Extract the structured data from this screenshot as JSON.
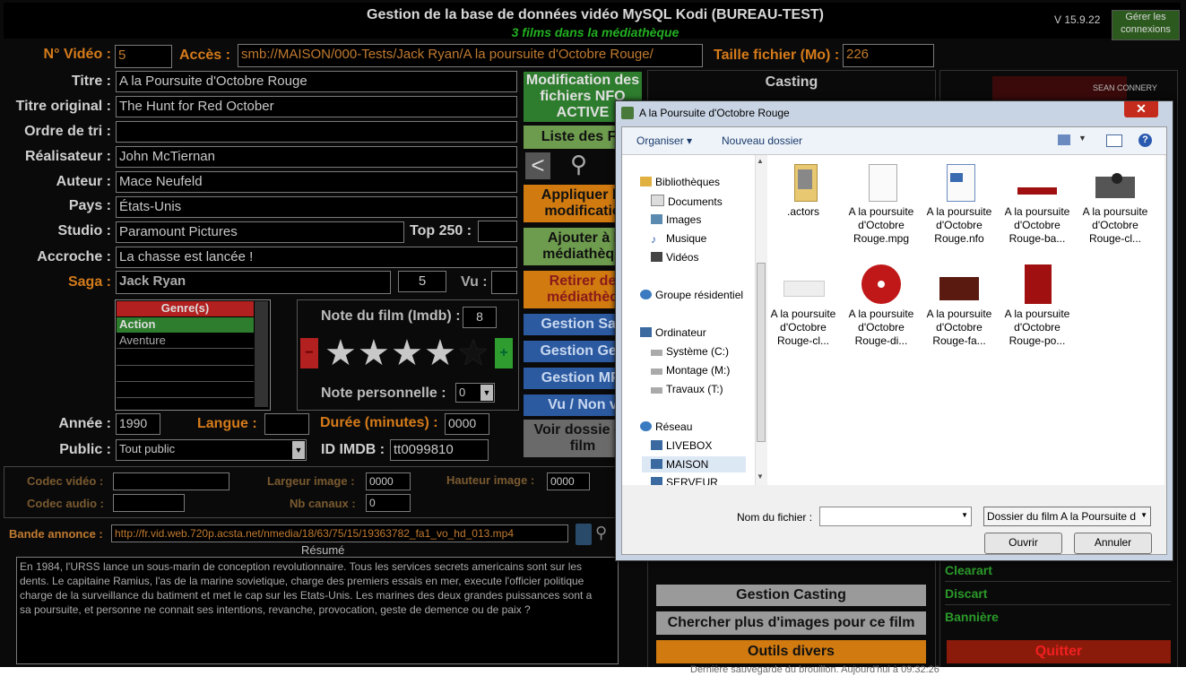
{
  "header": {
    "title": "Gestion de la base de données vidéo MySQL Kodi (BUREAU-TEST)",
    "subtitle": "3 films dans la médiathèque",
    "version": "V 15.9.22",
    "connections_button": "Gérer les connexions"
  },
  "form": {
    "video_no_label": "N° Vidéo :",
    "video_no": "5",
    "acces_label": "Accès :",
    "acces": "smb://MAISON/000-Tests/Jack Ryan/A la poursuite d'Octobre Rouge/",
    "taille_label": "Taille fichier (Mo) :",
    "taille": "226",
    "titre_label": "Titre :",
    "titre": "A la Poursuite d'Octobre Rouge",
    "titre_original_label": "Titre original :",
    "titre_original": "The Hunt for Red October",
    "ordre_label": "Ordre de tri :",
    "ordre": "",
    "realisateur_label": "Réalisateur :",
    "realisateur": "John McTiernan",
    "auteur_label": "Auteur :",
    "auteur": "Mace Neufeld",
    "pays_label": "Pays :",
    "pays": "États-Unis",
    "studio_label": "Studio :",
    "studio": "Paramount Pictures",
    "top250_label": "Top 250 :",
    "top250": "",
    "accroche_label": "Accroche :",
    "accroche": "La chasse est lancée !",
    "saga_label": "Saga :",
    "saga": "Jack Ryan",
    "saga_num": "5",
    "vu_label": "Vu :",
    "vu": "",
    "genres_header": "Genre(s)",
    "genres": [
      "Action",
      "Aventure",
      "",
      "",
      "",
      ""
    ],
    "note_label": "Note du film (Imdb) :",
    "note": "8",
    "stars_filled": 4,
    "stars_total": 5,
    "note_perso_label": "Note personnelle :",
    "note_perso": "0",
    "annee_label": "Année :",
    "annee": "1990",
    "langue_label": "Langue :",
    "langue": "",
    "duree_label": "Durée (minutes) :",
    "duree": "0000",
    "public_label": "Public :",
    "public": "Tout public",
    "imdb_label": "ID IMDB :",
    "imdb": "tt0099810",
    "codec_video_label": "Codec vidéo :",
    "codec_video": "",
    "largeur_label": "Largeur image :",
    "largeur": "0000",
    "hauteur_label": "Hauteur image :",
    "hauteur": "0000",
    "codec_audio_label": "Codec audio :",
    "codec_audio": "",
    "canaux_label": "Nb canaux :",
    "canaux": "0",
    "bande_label": "Bande annonce :",
    "bande": "http://fr.vid.web.720p.acsta.net/nmedia/18/63/75/15/19363782_fa1_vo_hd_013.mp4",
    "resume_label": "Résumé",
    "resume": "En 1984, l'URSS lance un sous-marin de conception revolutionnaire. Tous les services secrets americains sont sur les dents. Le capitaine Ramius, l'as de la marine sovietique, charge des premiers essais en mer, execute l'officier politique charge de la surveillance du batiment et met le cap sur les Etats-Unis. Les marines des deux grandes puissances sont a sa poursuite, et personne ne connait ses intentions, revanche, provocation, geste de demence ou de paix ?"
  },
  "buttons": {
    "modification": "Modification des fichiers NFO ACTIVE",
    "liste": "Liste des Fil",
    "appliquer": "Appliquer le modificatio",
    "ajouter": "Ajouter à l médiathèqu",
    "retirer": "Retirer de médiathèq",
    "gestion_saga": "Gestion Sag",
    "gestion_genre": "Gestion Gen",
    "gestion_mpaa": "Gestion MP/",
    "vu_non_vu": "Vu / Non v",
    "voir_dossier": "Voir dossie du film",
    "casting": "Casting",
    "gestion_casting": "Gestion Casting",
    "chercher_images": "Chercher plus d'images pour ce film",
    "outils": "Outils divers",
    "clearart": "Clearart",
    "discart": "Discart",
    "banniere": "Bannière",
    "quitter": "Quitter",
    "poster_text": "SEAN CONNERY"
  },
  "statusbar": "Dernière sauvegarde du brouillon. Aujourd'hui à 09:32:26",
  "dialog": {
    "title": "A la Poursuite d'Octobre Rouge",
    "close": "✕",
    "organiser": "Organiser ▾",
    "nouveau_dossier": "Nouveau dossier",
    "nav": [
      {
        "label": "Bibliothèques",
        "level": 0
      },
      {
        "label": "Documents",
        "level": 1
      },
      {
        "label": "Images",
        "level": 1
      },
      {
        "label": "Musique",
        "level": 1
      },
      {
        "label": "Vidéos",
        "level": 1
      },
      {
        "label": "Groupe résidentiel",
        "level": 0
      },
      {
        "label": "Ordinateur",
        "level": 0
      },
      {
        "label": "Système (C:)",
        "level": 1
      },
      {
        "label": "Montage (M:)",
        "level": 1
      },
      {
        "label": "Travaux (T:)",
        "level": 1
      },
      {
        "label": "Réseau",
        "level": 0
      },
      {
        "label": "LIVEBOX",
        "level": 1
      },
      {
        "label": "MAISON",
        "level": 1
      },
      {
        "label": "SERVEUR",
        "level": 1
      }
    ],
    "files": [
      {
        "name": ".actors",
        "kind": "folder"
      },
      {
        "name": "A la poursuite d'Octobre Rouge.mpg",
        "kind": "blank"
      },
      {
        "name": "A la poursuite d'Octobre Rouge.nfo",
        "kind": "nfo"
      },
      {
        "name": "A la poursuite d'Octobre Rouge-ba...",
        "kind": "banner"
      },
      {
        "name": "A la poursuite d'Octobre Rouge-cl...",
        "kind": "photo"
      },
      {
        "name": "A la poursuite d'Octobre Rouge-cl...",
        "kind": "clearlogo"
      },
      {
        "name": "A la poursuite d'Octobre Rouge-di...",
        "kind": "disc"
      },
      {
        "name": "A la poursuite d'Octobre Rouge-fa...",
        "kind": "fanart"
      },
      {
        "name": "A la poursuite d'Octobre Rouge-po...",
        "kind": "poster"
      }
    ],
    "filename_label": "Nom du fichier :",
    "filename": "",
    "filter": "Dossier du film A la Poursuite d",
    "ouvrir": "Ouvrir",
    "annuler": "Annuler"
  }
}
